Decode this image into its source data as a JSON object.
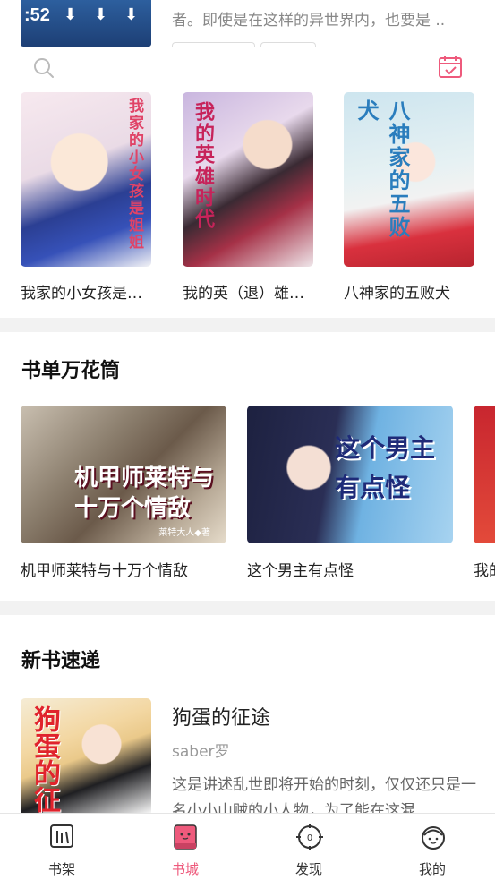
{
  "top": {
    "status_time": ":52",
    "description": "者。即使是在这样的异世界内，也要是 .."
  },
  "recommended": [
    {
      "name": "我家的小女孩是…",
      "cover_text": "我家的小女孩是姐姐"
    },
    {
      "name": "我的英（退）雄…",
      "cover_text": "我的英雄时代"
    },
    {
      "name": "八神家的五败犬",
      "cover_text": "八神家的五败犬"
    }
  ],
  "booklist_section": {
    "title": "书单万花筒",
    "items": [
      {
        "name": "机甲师莱特与十万个情敌",
        "cover_text": "机甲师莱特与十万个情敌",
        "cover_author": "莱特大人◆著"
      },
      {
        "name": "这个男主有点怪",
        "cover_text": "这个男主有点怪"
      },
      {
        "name": "我的"
      }
    ]
  },
  "newbook_section": {
    "title": "新书速递",
    "book": {
      "title": "狗蛋的征途",
      "author": "saber罗",
      "description": "这是讲述乱世即将开始的时刻，仅仅还只是一名小小山贼的小人物，为了能在这混",
      "cover_text": "狗蛋的征"
    }
  },
  "nav": [
    {
      "label": "书架",
      "icon": "bookshelf-icon"
    },
    {
      "label": "书城",
      "icon": "bookstore-icon",
      "active": true
    },
    {
      "label": "发现",
      "icon": "discover-icon"
    },
    {
      "label": "我的",
      "icon": "profile-icon"
    }
  ],
  "colors": {
    "accent": "#ee5a7c",
    "divider": "#f2f2f2"
  }
}
